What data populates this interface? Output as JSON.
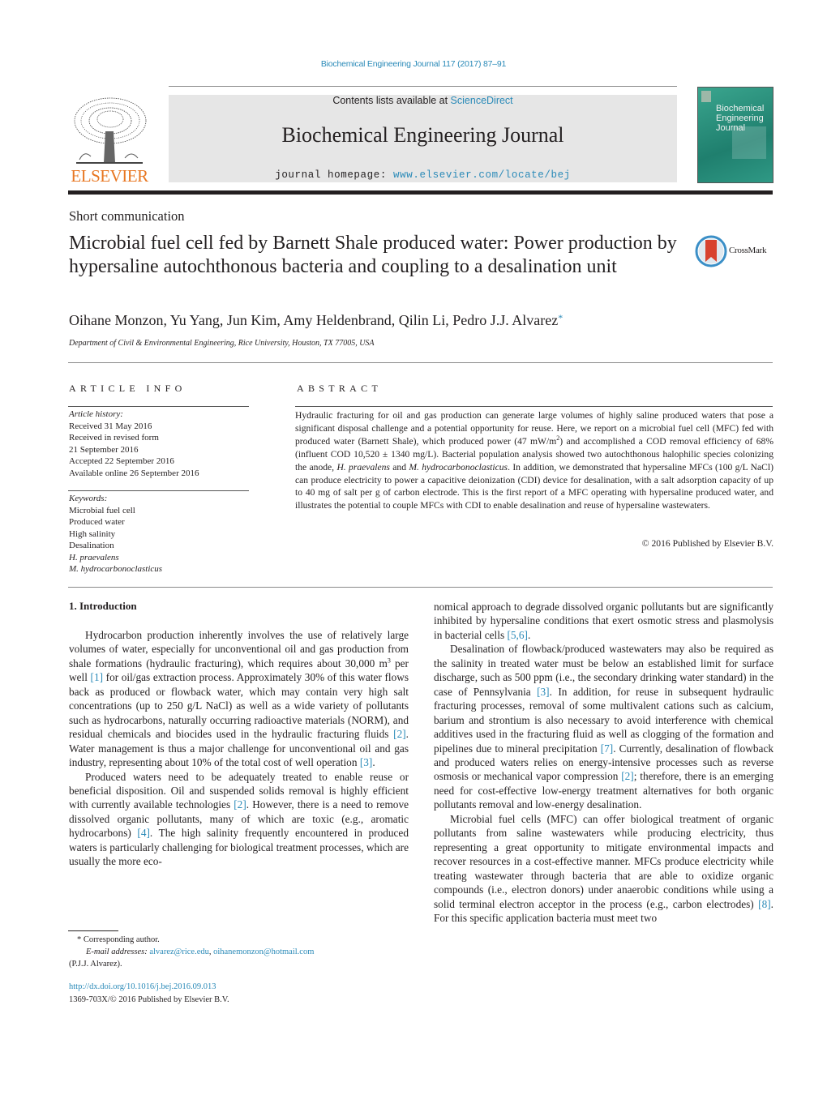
{
  "header": {
    "journal_reference": "Biochemical Engineering Journal 117 (2017) 87–91",
    "contents_prefix": "Contents lists available at ",
    "contents_link": "ScienceDirect",
    "journal_title": "Biochemical Engineering Journal",
    "homepage_prefix": "journal homepage: ",
    "homepage_link": "www.elsevier.com/locate/bej",
    "publisher_logo_text": "ELSEVIER",
    "cover_title_lines": [
      "Biochemical",
      "Engineering",
      "Journal"
    ],
    "colors": {
      "link": "#2a8ab8",
      "elsevier_orange": "#e87722",
      "cover_green": "#2a9482",
      "masthead_gray": "#e6e6e6"
    }
  },
  "article": {
    "type": "Short communication",
    "title": "Microbial fuel cell fed by Barnett Shale produced water: Power production by hypersaline autochthonous bacteria and coupling to a desalination unit",
    "crossmark_label": "CrossMark",
    "authors": "Oihane Monzon, Yu Yang, Jun Kim, Amy Heldenbrand, Qilin Li, Pedro J.J. Alvarez",
    "corresponding_marker": "*",
    "affiliation": "Department of Civil & Environmental Engineering, Rice University, Houston, TX 77005, USA"
  },
  "article_info": {
    "heading": "ARTICLE INFO",
    "history_label": "Article history:",
    "history": [
      "Received 31 May 2016",
      "Received in revised form",
      "21 September 2016",
      "Accepted 22 September 2016",
      "Available online 26 September 2016"
    ],
    "keywords_label": "Keywords:",
    "keywords": [
      {
        "text": "Microbial fuel cell",
        "italic": false
      },
      {
        "text": "Produced water",
        "italic": false
      },
      {
        "text": "High salinity",
        "italic": false
      },
      {
        "text": "Desalination",
        "italic": false
      },
      {
        "text": "H. praevalens",
        "italic": true
      },
      {
        "text": "M. hydrocarbonoclasticus",
        "italic": true
      }
    ]
  },
  "abstract": {
    "heading": "ABSTRACT",
    "p1": "Hydraulic fracturing for oil and gas production can generate large volumes of highly saline produced waters that pose a significant disposal challenge and a potential opportunity for reuse. Here, we report on a microbial fuel cell (MFC) fed with produced water (Barnett Shale), which produced power (47 mW/m",
    "p1_sup": "2",
    "p2": ") and accomplished a COD removal efficiency of 68% (influent COD 10,520 ± 1340 mg/L). Bacterial population analysis showed two autochthonous halophilic species colonizing the anode, ",
    "species1": "H. praevalens",
    "p3": " and ",
    "species2": "M. hydrocarbonoclasticus",
    "p4": ". In addition, we demonstrated that hypersaline MFCs (100 g/L NaCl) can produce electricity to power a capacitive deionization (CDI) device for desalination, with a salt adsorption capacity of up to 40 mg of salt per g of carbon electrode. This is the first report of a MFC operating with hypersaline produced water, and illustrates the potential to couple MFCs with CDI to enable desalination and reuse of hypersaline wastewaters.",
    "copyright": "© 2016 Published by Elsevier B.V."
  },
  "body": {
    "section_heading": "1.  Introduction",
    "left": {
      "p1a": "Hydrocarbon production inherently involves the use of relatively large volumes of water, especially for unconventional oil and gas production from shale formations (hydraulic fracturing), which requires about 30,000 m",
      "p1_sup": "3",
      "p1b": " per well ",
      "ref1": "[1]",
      "p1c": " for oil/gas extraction process. Approximately 30% of this water flows back as produced or flowback water, which may contain very high salt concentrations (up to 250 g/L NaCl) as well as a wide variety of pollutants such as hydrocarbons, naturally occurring radioactive materials (NORM), and residual chemicals and biocides used in the hydraulic fracturing fluids ",
      "ref2": "[2]",
      "p1d": ". Water management is thus a major challenge for unconventional oil and gas industry, representing about 10% of the total cost of well operation ",
      "ref3": "[3]",
      "p1e": ".",
      "p2a": "Produced waters need to be adequately treated to enable reuse or beneficial disposition. Oil and suspended solids removal is highly efficient with currently available technologies ",
      "ref4": "[2]",
      "p2b": ". However, there is a need to remove dissolved organic pollutants, many of which are toxic (e.g., aromatic hydrocarbons) ",
      "ref5": "[4]",
      "p2c": ". The high salinity frequently encountered in produced waters is particularly challenging for biological treatment processes, which are usually the more eco-"
    },
    "right": {
      "p0a": "nomical approach to degrade dissolved organic pollutants but are significantly inhibited by hypersaline conditions that exert osmotic stress and plasmolysis in bacterial cells ",
      "ref56": "[5,6]",
      "p0b": ".",
      "p1a": "Desalination of flowback/produced wastewaters may also be required as the salinity in treated water must be below an established limit for surface discharge, such as 500 ppm (i.e., the secondary drinking water standard) in the case of Pennsylvania ",
      "ref3": "[3]",
      "p1b": ". In addition, for reuse in subsequent hydraulic fracturing processes, removal of some multivalent cations such as calcium, barium and strontium is also necessary to avoid interference with chemical additives used in the fracturing fluid as well as clogging of the formation and pipelines due to mineral precipitation ",
      "ref7": "[7]",
      "p1c": ". Currently, desalination of flowback and produced waters relies on energy-intensive processes such as reverse osmosis or mechanical vapor compression ",
      "ref2": "[2]",
      "p1d": "; therefore, there is an emerging need for cost-effective low-energy treatment alternatives for both organic pollutants removal and low-energy desalination.",
      "p2a": "Microbial fuel cells (MFC) can offer biological treatment of organic pollutants from saline wastewaters while producing electricity, thus representing a great opportunity to mitigate environmental impacts and recover resources in a cost-effective manner. MFCs produce electricity while treating wastewater through bacteria that are able to oxidize organic compounds (i.e., electron donors) under anaerobic conditions while using a solid terminal electron acceptor in the process (e.g., carbon electrodes) ",
      "ref8": "[8]",
      "p2b": ". For this specific application bacteria must meet two"
    }
  },
  "footnotes": {
    "corresponding": "* Corresponding author.",
    "email_label": "E-mail addresses: ",
    "email1": "alvarez@rice.edu",
    "email_sep": ", ",
    "email2": "oihanemonzon@hotmail.com",
    "email_owner": "(P.J.J. Alvarez).",
    "doi": "http://dx.doi.org/10.1016/j.bej.2016.09.013",
    "issn": "1369-703X/© 2016 Published by Elsevier B.V."
  }
}
